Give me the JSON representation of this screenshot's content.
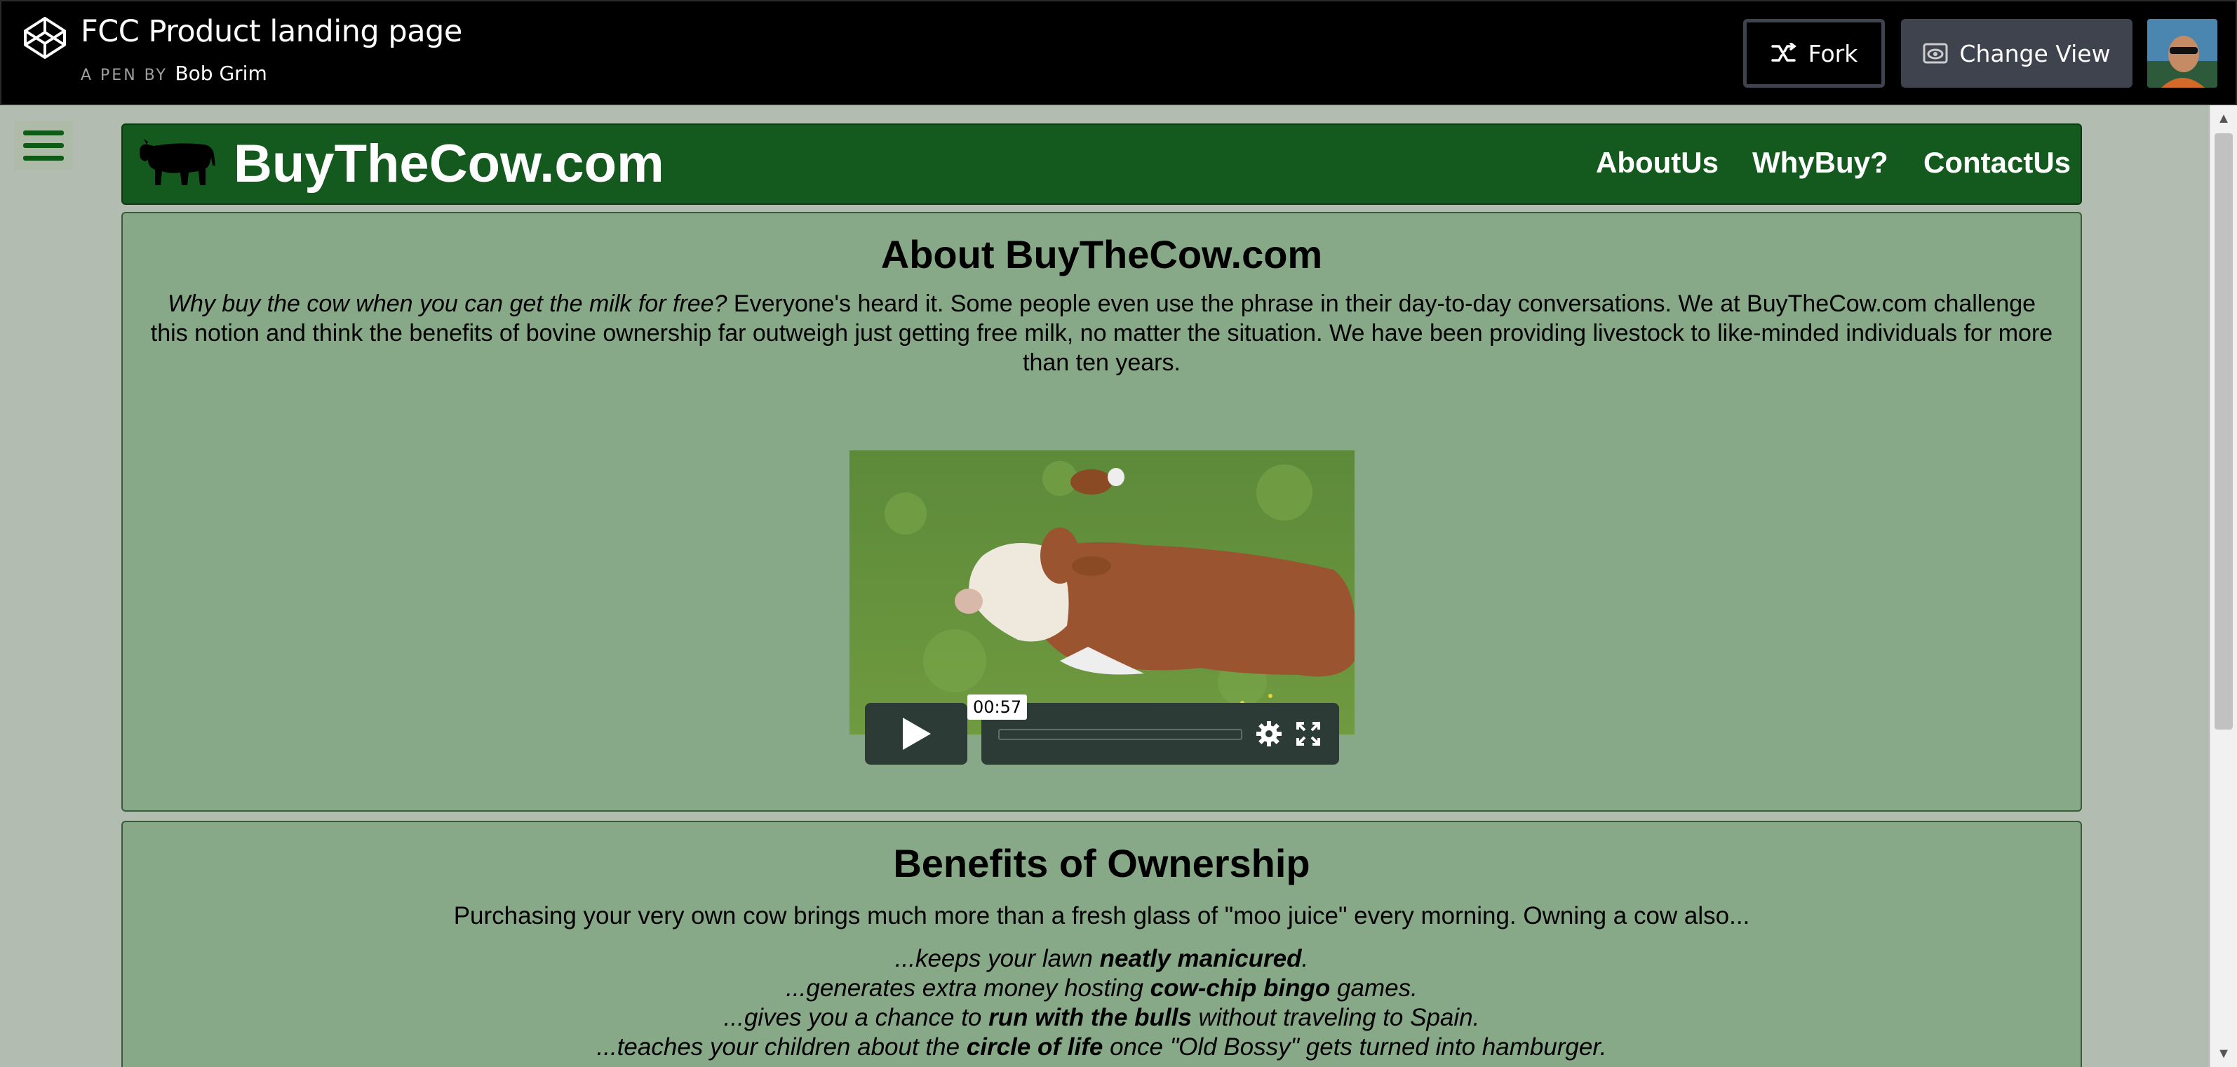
{
  "codepen": {
    "title": "FCC Product landing page",
    "by_prefix": "A PEN BY",
    "author": "Bob Grim",
    "fork_label": "Fork",
    "change_view_label": "Change View"
  },
  "site": {
    "brand": "BuyTheCow.com",
    "nav": [
      "AboutUs",
      "WhyBuy?",
      "ContactUs"
    ],
    "brand_color": "#145a1e",
    "section_color": "#87a987"
  },
  "about": {
    "title": "About BuyTheCow.com",
    "quote": "Why buy the cow when you can get the milk for free?",
    "text": " Everyone's heard it. Some people even use the phrase in their day-to-day conversations. We at BuyTheCow.com challenge this notion and think the benefits of bovine ownership far outweigh just getting free milk, no matter the situation. We have been providing livestock to like-minded individuals for more than ten years.",
    "video_time": "00:57",
    "video_progress": 0
  },
  "benefits": {
    "title": "Benefits of Ownership",
    "intro": "Purchasing your very own cow brings much more than a fresh glass of \"moo juice\" every morning. Owning a cow also...",
    "items": [
      {
        "pre": "...keeps your lawn ",
        "bold": "neatly manicured",
        "post": "."
      },
      {
        "pre": "...generates extra money hosting ",
        "bold": "cow-chip bingo",
        "post": " games."
      },
      {
        "pre": "...gives you a chance to ",
        "bold": "run with the bulls",
        "post": " without traveling to Spain."
      },
      {
        "pre": "...teaches your children about the ",
        "bold": "circle of life",
        "post": " once \"Old Bossy\" gets turned into hamburger."
      }
    ]
  }
}
